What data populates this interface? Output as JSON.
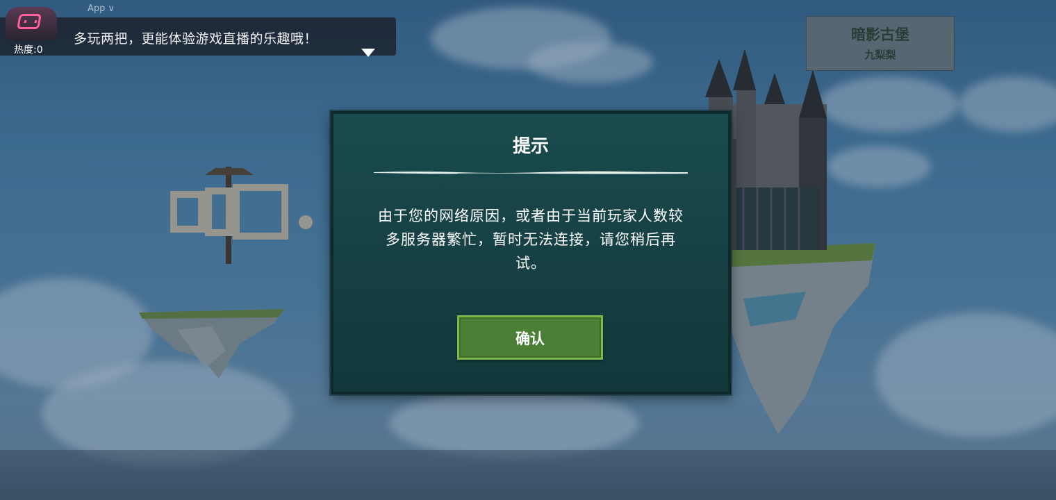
{
  "overlay": {
    "app_label": "App ∨",
    "heat_label": "热度:0",
    "tip_text": "多玩两把，更能体验游戏直播的乐趣哦！",
    "logo_icon": "live-stream-logo-icon",
    "dropdown_icon": "triangle-down-icon"
  },
  "server": {
    "name": "暗影古堡",
    "owner": "九梨梨"
  },
  "dialog": {
    "title": "提示",
    "message": "由于您的网络原因，或者由于当前玩家人数较多服务器繁忙，暂时无法连接，请您稍后再试。",
    "confirm_label": "确认"
  },
  "colors": {
    "modal_bg": "#164043",
    "confirm_bg": "#4c7f36",
    "logo_pink": "#ff5f9a"
  }
}
